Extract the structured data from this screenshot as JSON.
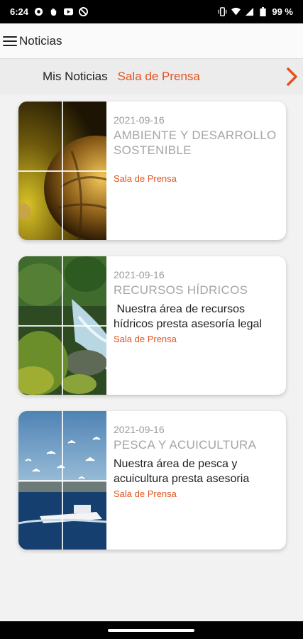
{
  "status_bar": {
    "time": "6:24",
    "battery": "99 %",
    "left_icons": [
      "app-notification-icon",
      "hand-icon",
      "youtube-icon",
      "no-disturb-icon"
    ],
    "right_icons": [
      "vibrate-icon",
      "wifi-icon",
      "signal-icon",
      "battery-icon"
    ]
  },
  "app_bar": {
    "title": "Noticias"
  },
  "tabs": [
    {
      "label": "Mis Noticias",
      "active": false
    },
    {
      "label": "Sala de Prensa",
      "active": true
    }
  ],
  "colors": {
    "accent": "#e1531f",
    "muted_text": "#a5a5a5",
    "card_bg": "#ffffff",
    "screen_bg": "#f2f2f2"
  },
  "news": [
    {
      "date": "2021-09-16",
      "title": "AMBIENTE Y DESARROLLO SOSTENIBLE",
      "summary": "",
      "source": "Sala de Prensa",
      "image": "globe-in-hand"
    },
    {
      "date": "2021-09-16",
      "title": "RECURSOS HÍDRICOS",
      "summary": " Nuestra área de recursos hídricos presta asesoría legal",
      "source": "Sala de Prensa",
      "image": "river-forest"
    },
    {
      "date": "2021-09-16",
      "title": "PESCA Y ACUICULTURA",
      "summary": "Nuestra área de pesca y acuicultura presta asesoria",
      "source": "Sala de Prensa",
      "image": "boat-seagulls"
    }
  ]
}
